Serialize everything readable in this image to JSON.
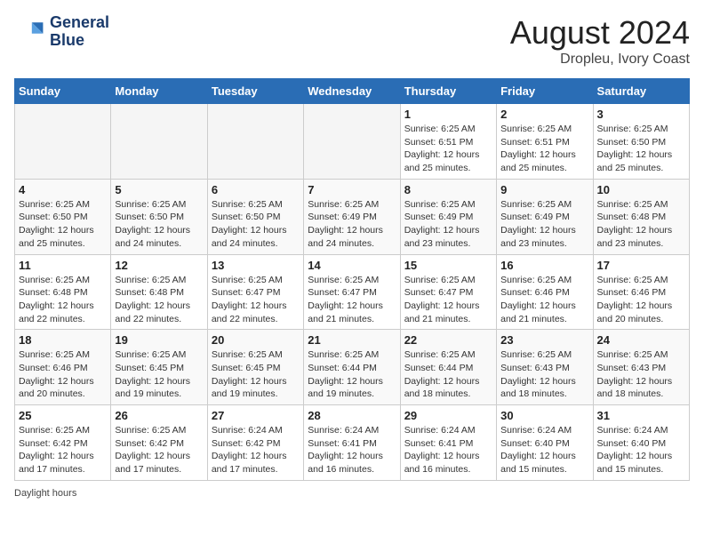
{
  "header": {
    "logo_line1": "General",
    "logo_line2": "Blue",
    "main_title": "August 2024",
    "subtitle": "Dropleu, Ivory Coast"
  },
  "days_of_week": [
    "Sunday",
    "Monday",
    "Tuesday",
    "Wednesday",
    "Thursday",
    "Friday",
    "Saturday"
  ],
  "weeks": [
    [
      {
        "day": "",
        "info": ""
      },
      {
        "day": "",
        "info": ""
      },
      {
        "day": "",
        "info": ""
      },
      {
        "day": "",
        "info": ""
      },
      {
        "day": "1",
        "sunrise": "Sunrise: 6:25 AM",
        "sunset": "Sunset: 6:51 PM",
        "daylight": "Daylight: 12 hours and 25 minutes."
      },
      {
        "day": "2",
        "sunrise": "Sunrise: 6:25 AM",
        "sunset": "Sunset: 6:51 PM",
        "daylight": "Daylight: 12 hours and 25 minutes."
      },
      {
        "day": "3",
        "sunrise": "Sunrise: 6:25 AM",
        "sunset": "Sunset: 6:50 PM",
        "daylight": "Daylight: 12 hours and 25 minutes."
      }
    ],
    [
      {
        "day": "4",
        "sunrise": "Sunrise: 6:25 AM",
        "sunset": "Sunset: 6:50 PM",
        "daylight": "Daylight: 12 hours and 25 minutes."
      },
      {
        "day": "5",
        "sunrise": "Sunrise: 6:25 AM",
        "sunset": "Sunset: 6:50 PM",
        "daylight": "Daylight: 12 hours and 24 minutes."
      },
      {
        "day": "6",
        "sunrise": "Sunrise: 6:25 AM",
        "sunset": "Sunset: 6:50 PM",
        "daylight": "Daylight: 12 hours and 24 minutes."
      },
      {
        "day": "7",
        "sunrise": "Sunrise: 6:25 AM",
        "sunset": "Sunset: 6:49 PM",
        "daylight": "Daylight: 12 hours and 24 minutes."
      },
      {
        "day": "8",
        "sunrise": "Sunrise: 6:25 AM",
        "sunset": "Sunset: 6:49 PM",
        "daylight": "Daylight: 12 hours and 23 minutes."
      },
      {
        "day": "9",
        "sunrise": "Sunrise: 6:25 AM",
        "sunset": "Sunset: 6:49 PM",
        "daylight": "Daylight: 12 hours and 23 minutes."
      },
      {
        "day": "10",
        "sunrise": "Sunrise: 6:25 AM",
        "sunset": "Sunset: 6:48 PM",
        "daylight": "Daylight: 12 hours and 23 minutes."
      }
    ],
    [
      {
        "day": "11",
        "sunrise": "Sunrise: 6:25 AM",
        "sunset": "Sunset: 6:48 PM",
        "daylight": "Daylight: 12 hours and 22 minutes."
      },
      {
        "day": "12",
        "sunrise": "Sunrise: 6:25 AM",
        "sunset": "Sunset: 6:48 PM",
        "daylight": "Daylight: 12 hours and 22 minutes."
      },
      {
        "day": "13",
        "sunrise": "Sunrise: 6:25 AM",
        "sunset": "Sunset: 6:47 PM",
        "daylight": "Daylight: 12 hours and 22 minutes."
      },
      {
        "day": "14",
        "sunrise": "Sunrise: 6:25 AM",
        "sunset": "Sunset: 6:47 PM",
        "daylight": "Daylight: 12 hours and 21 minutes."
      },
      {
        "day": "15",
        "sunrise": "Sunrise: 6:25 AM",
        "sunset": "Sunset: 6:47 PM",
        "daylight": "Daylight: 12 hours and 21 minutes."
      },
      {
        "day": "16",
        "sunrise": "Sunrise: 6:25 AM",
        "sunset": "Sunset: 6:46 PM",
        "daylight": "Daylight: 12 hours and 21 minutes."
      },
      {
        "day": "17",
        "sunrise": "Sunrise: 6:25 AM",
        "sunset": "Sunset: 6:46 PM",
        "daylight": "Daylight: 12 hours and 20 minutes."
      }
    ],
    [
      {
        "day": "18",
        "sunrise": "Sunrise: 6:25 AM",
        "sunset": "Sunset: 6:46 PM",
        "daylight": "Daylight: 12 hours and 20 minutes."
      },
      {
        "day": "19",
        "sunrise": "Sunrise: 6:25 AM",
        "sunset": "Sunset: 6:45 PM",
        "daylight": "Daylight: 12 hours and 19 minutes."
      },
      {
        "day": "20",
        "sunrise": "Sunrise: 6:25 AM",
        "sunset": "Sunset: 6:45 PM",
        "daylight": "Daylight: 12 hours and 19 minutes."
      },
      {
        "day": "21",
        "sunrise": "Sunrise: 6:25 AM",
        "sunset": "Sunset: 6:44 PM",
        "daylight": "Daylight: 12 hours and 19 minutes."
      },
      {
        "day": "22",
        "sunrise": "Sunrise: 6:25 AM",
        "sunset": "Sunset: 6:44 PM",
        "daylight": "Daylight: 12 hours and 18 minutes."
      },
      {
        "day": "23",
        "sunrise": "Sunrise: 6:25 AM",
        "sunset": "Sunset: 6:43 PM",
        "daylight": "Daylight: 12 hours and 18 minutes."
      },
      {
        "day": "24",
        "sunrise": "Sunrise: 6:25 AM",
        "sunset": "Sunset: 6:43 PM",
        "daylight": "Daylight: 12 hours and 18 minutes."
      }
    ],
    [
      {
        "day": "25",
        "sunrise": "Sunrise: 6:25 AM",
        "sunset": "Sunset: 6:42 PM",
        "daylight": "Daylight: 12 hours and 17 minutes."
      },
      {
        "day": "26",
        "sunrise": "Sunrise: 6:25 AM",
        "sunset": "Sunset: 6:42 PM",
        "daylight": "Daylight: 12 hours and 17 minutes."
      },
      {
        "day": "27",
        "sunrise": "Sunrise: 6:24 AM",
        "sunset": "Sunset: 6:42 PM",
        "daylight": "Daylight: 12 hours and 17 minutes."
      },
      {
        "day": "28",
        "sunrise": "Sunrise: 6:24 AM",
        "sunset": "Sunset: 6:41 PM",
        "daylight": "Daylight: 12 hours and 16 minutes."
      },
      {
        "day": "29",
        "sunrise": "Sunrise: 6:24 AM",
        "sunset": "Sunset: 6:41 PM",
        "daylight": "Daylight: 12 hours and 16 minutes."
      },
      {
        "day": "30",
        "sunrise": "Sunrise: 6:24 AM",
        "sunset": "Sunset: 6:40 PM",
        "daylight": "Daylight: 12 hours and 15 minutes."
      },
      {
        "day": "31",
        "sunrise": "Sunrise: 6:24 AM",
        "sunset": "Sunset: 6:40 PM",
        "daylight": "Daylight: 12 hours and 15 minutes."
      }
    ]
  ],
  "footer": {
    "daylight_label": "Daylight hours"
  }
}
